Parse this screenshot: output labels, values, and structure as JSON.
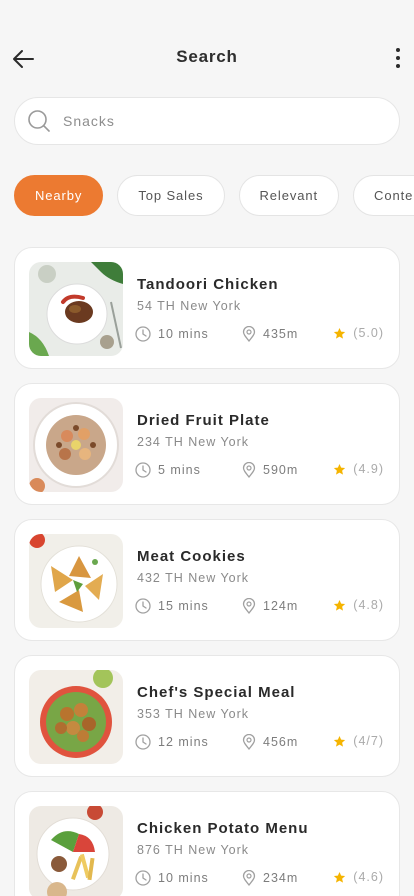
{
  "header": {
    "title": "Search"
  },
  "search": {
    "placeholder": "Snacks"
  },
  "chips": [
    "Nearby",
    "Top Sales",
    "Relevant",
    "Content"
  ],
  "items": [
    {
      "name": "Tandoori Chicken",
      "address": "54 TH New York",
      "time": "10 mins",
      "distance": "435m",
      "rating": "(5.0)"
    },
    {
      "name": "Dried Fruit Plate",
      "address": "234 TH New York",
      "time": "5 mins",
      "distance": "590m",
      "rating": "(4.9)"
    },
    {
      "name": "Meat Cookies",
      "address": "432 TH New York",
      "time": "15 mins",
      "distance": "124m",
      "rating": "(4.8)"
    },
    {
      "name": "Chef's Special Meal",
      "address": "353 TH New York",
      "time": "12 mins",
      "distance": "456m",
      "rating": "(4/7)"
    },
    {
      "name": "Chicken Potato Menu",
      "address": "876 TH New York",
      "time": "10 mins",
      "distance": "234m",
      "rating": "(4.6)"
    }
  ],
  "colors": {
    "accent": "#ec7a31",
    "star": "#f5b400",
    "background": "#f6f6f6"
  }
}
